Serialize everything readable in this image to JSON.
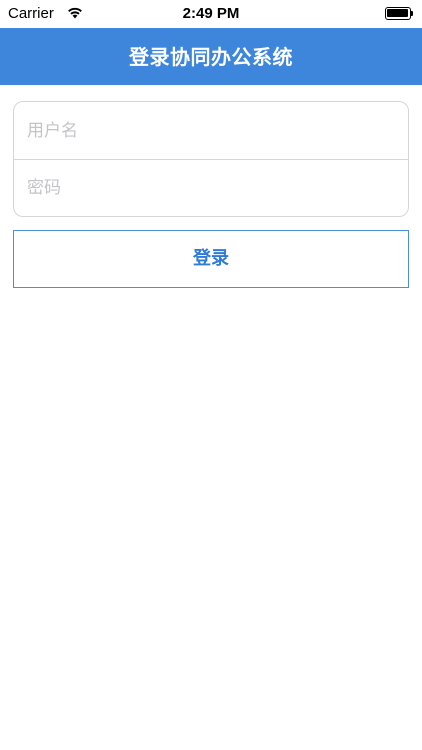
{
  "status_bar": {
    "carrier": "Carrier",
    "time": "2:49 PM",
    "wifi_icon": "wifi-icon",
    "battery_icon": "battery-icon"
  },
  "nav": {
    "title": "登录协同办公系统",
    "background_color": "#3d86db"
  },
  "form": {
    "username": {
      "placeholder": "用户名",
      "value": ""
    },
    "password": {
      "placeholder": "密码",
      "value": ""
    },
    "login_label": "登录"
  },
  "colors": {
    "accent": "#2f7bd6",
    "border": "#d6d6d6",
    "placeholder": "#c4c4c8"
  }
}
